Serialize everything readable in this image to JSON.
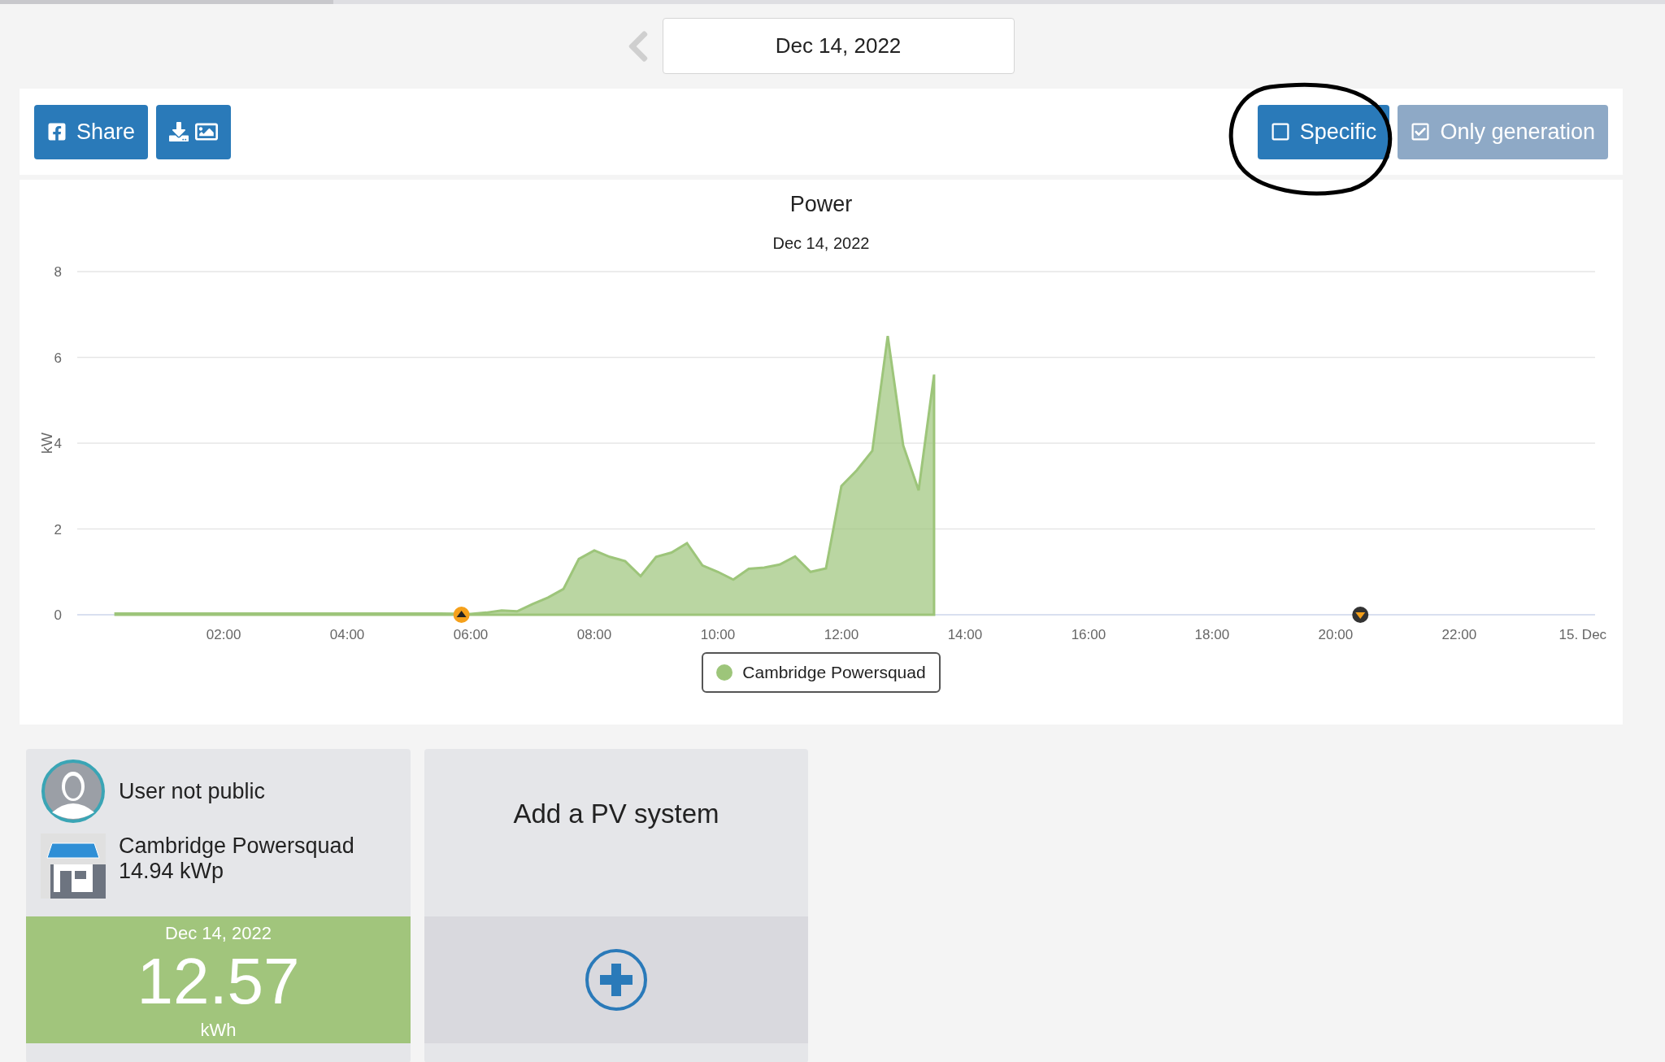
{
  "date_nav": {
    "date": "Dec 14, 2022"
  },
  "toolbar": {
    "share_label": "Share",
    "toggles": [
      {
        "label": "Specific",
        "checked": false
      },
      {
        "label": "Only generation",
        "checked": true
      }
    ]
  },
  "chart": {
    "subtitle": "Dec 14, 2022",
    "chart_data": {
      "type": "area",
      "title": "Power",
      "ylabel": "kW",
      "xlim": [
        -0.37,
        24.2
      ],
      "grid": true,
      "ylim": [
        0,
        8
      ],
      "yticks": [
        0,
        2,
        4,
        6,
        8
      ],
      "xticks": [
        {
          "value": 2,
          "label": "02:00"
        },
        {
          "value": 4,
          "label": "04:00"
        },
        {
          "value": 6,
          "label": "06:00"
        },
        {
          "value": 8,
          "label": "08:00"
        },
        {
          "value": 10,
          "label": "10:00"
        },
        {
          "value": 12,
          "label": "12:00"
        },
        {
          "value": 14,
          "label": "14:00"
        },
        {
          "value": 16,
          "label": "16:00"
        },
        {
          "value": 18,
          "label": "18:00"
        },
        {
          "value": 20,
          "label": "20:00"
        },
        {
          "value": 22,
          "label": "22:00"
        },
        {
          "value": 24,
          "label": "15. Dec"
        }
      ],
      "x": [
        0.25,
        0.5,
        0.75,
        1,
        1.25,
        1.5,
        1.75,
        2,
        2.25,
        2.5,
        2.75,
        3,
        3.25,
        3.5,
        3.75,
        4,
        4.25,
        4.5,
        4.75,
        5,
        5.25,
        5.5,
        5.75,
        6,
        6.25,
        6.5,
        6.75,
        7,
        7.25,
        7.5,
        7.75,
        8,
        8.25,
        8.5,
        8.75,
        9,
        9.25,
        9.5,
        9.75,
        10,
        10.25,
        10.5,
        10.75,
        11,
        11.25,
        11.5,
        11.75,
        12,
        12.25,
        12.5,
        12.75,
        13,
        13.25,
        13.5
      ],
      "series": [
        {
          "name": "Cambridge Powersquad",
          "color": "#9dc57a",
          "values": [
            0.03,
            0.03,
            0.03,
            0.03,
            0.03,
            0.03,
            0.03,
            0.03,
            0.03,
            0.03,
            0.03,
            0.03,
            0.03,
            0.03,
            0.03,
            0.03,
            0.03,
            0.03,
            0.03,
            0.03,
            0.03,
            0.03,
            null,
            0.02,
            0.05,
            0.1,
            0.08,
            0.25,
            0.4,
            0.6,
            1.3,
            1.5,
            1.35,
            1.25,
            0.9,
            1.35,
            1.45,
            1.67,
            1.15,
            1.0,
            0.82,
            1.07,
            1.1,
            1.17,
            1.36,
            1.0,
            1.08,
            3.0,
            3.37,
            3.82,
            6.5,
            3.95,
            2.9,
            5.6
          ]
        }
      ]
    }
  },
  "cards": [
    {
      "kind": "system",
      "owner": "User not public",
      "system_name": "Cambridge Powersquad",
      "capacity": "14.94 kWp",
      "date": "Dec 14, 2022",
      "energy": "12.57",
      "unit": "kWh"
    },
    {
      "kind": "add",
      "title": "Add a PV system"
    }
  ]
}
